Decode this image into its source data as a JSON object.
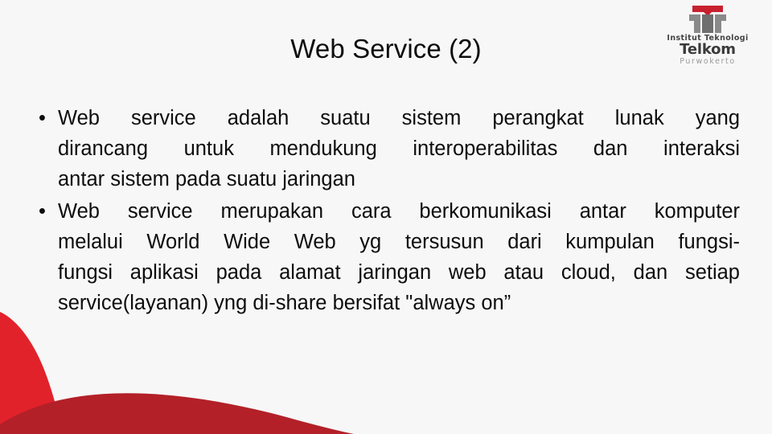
{
  "slide": {
    "title": "Web Service (2)",
    "bullets": [
      {
        "lines": [
          "Web service adalah suatu sistem perangkat lunak yang",
          "dirancang untuk mendukung interoperabilitas dan interaksi",
          "antar sistem pada suatu jaringan"
        ]
      },
      {
        "lines": [
          "Web service merupakan cara berkomunikasi antar komputer",
          "melalui World Wide Web yg tersusun dari kumpulan fungsi-",
          "fungsi aplikasi pada alamat jaringan web atau cloud, dan setiap",
          "service(layanan) yng di-share bersifat \"always on”"
        ]
      }
    ]
  },
  "logo": {
    "mark_name": "telkom-t-mark",
    "line1": "Institut Teknologi",
    "line2": "Telkom",
    "line3": "Purwokerto",
    "colors": {
      "mark_red": "#c8202e",
      "mark_gray": "#808080",
      "text_dark": "#3b3b3b",
      "text_light": "#9a9a9a"
    }
  },
  "decoration": {
    "name": "red-corner-swoosh",
    "colors": {
      "bright_red": "#e2222b",
      "dark_red": "#b32028"
    }
  },
  "theme": {
    "background": "#f7f7f7",
    "text": "#0d0d0d"
  }
}
